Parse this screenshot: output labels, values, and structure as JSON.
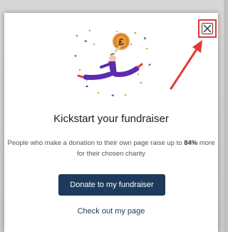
{
  "modal": {
    "title": "Kickstart your fundraiser",
    "body_pre": "People who make a donation to their own page raise up to ",
    "body_bold": "84%",
    "body_post": " more for their chosen charity",
    "primary_button": "Donate to my fundraiser",
    "secondary_link": "Check out my page",
    "coin_symbol": "£",
    "close_icon": "close-icon"
  },
  "colors": {
    "primary": "#1d3a5c",
    "highlight": "#e53935",
    "figure": "#5b2bb0",
    "coin": "#e89a3c"
  }
}
